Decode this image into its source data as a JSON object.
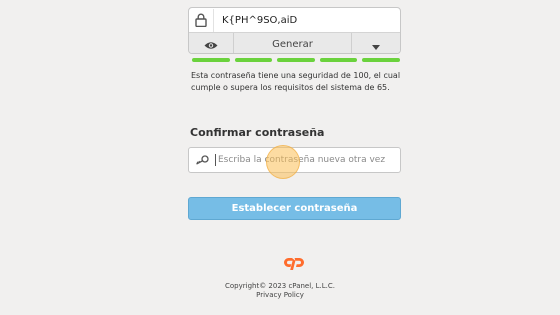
{
  "password_field": {
    "value": "K{PH^9SO,aiD",
    "generate_label": "Generar",
    "icons": [
      "lock-icon",
      "eye-icon",
      "caret-down-icon"
    ]
  },
  "strength": {
    "segments_filled": 5,
    "segments_total": 5,
    "color": "#6bd23d",
    "message": "Esta contraseña tiene una seguridad de 100, el cual cumple o supera los requisitos del sistema de 65."
  },
  "confirm": {
    "label": "Confirmar contraseña",
    "placeholder": "Escriba la contraseña nueva otra vez",
    "icon": "key-icon"
  },
  "submit": {
    "label": "Establecer contraseña",
    "color": "#76bde6"
  },
  "footer": {
    "logo": "cpanel-logo",
    "logo_color": "#ff6c2c",
    "copyright": "Copyright© 2023 cPanel, L.L.C.",
    "privacy": "Privacy Policy"
  }
}
